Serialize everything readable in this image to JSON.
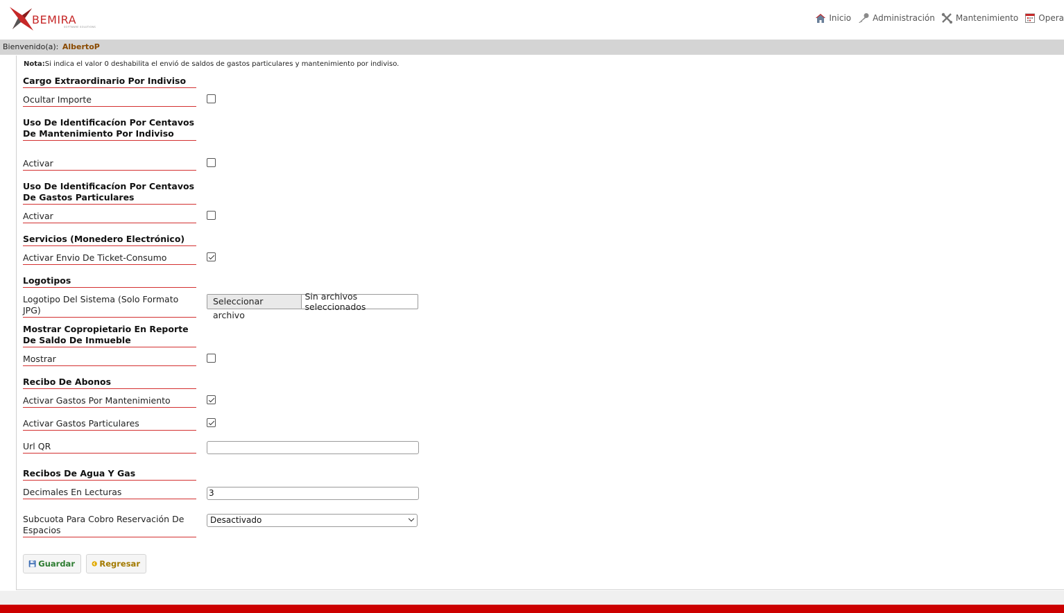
{
  "brand": {
    "logo_text": "BEMIRA",
    "logo_tagline": "SOFTWARE SOLUTIONS"
  },
  "topnav": [
    {
      "label": "Inicio",
      "icon": "home-icon"
    },
    {
      "label": "Administración",
      "icon": "key-icon"
    },
    {
      "label": "Mantenimiento",
      "icon": "tools-icon"
    },
    {
      "label": "Opera",
      "icon": "calendar-icon"
    }
  ],
  "welcome": {
    "prefix": "Bienvenido(a):",
    "user": "AlbertoP"
  },
  "note": {
    "label": "Nota:",
    "text": "Si indica el valor 0 deshabilita el envió de saldos de gastos particulares y mantenimiento por indiviso."
  },
  "form": {
    "cargo_heading": "Cargo Extraordinario Por Indiviso",
    "ocultar_importe": {
      "label": "Ocultar Importe",
      "checked": false
    },
    "uso_mant_heading": "Uso De Identificacíon Por Centavos De Mantenimiento Por Indiviso",
    "uso_mant_activar": {
      "label": "Activar",
      "checked": false
    },
    "uso_gastos_heading": "Uso De Identificacíon Por Centavos De Gastos Particulares",
    "uso_gastos_activar": {
      "label": "Activar",
      "checked": false
    },
    "servicios_heading": "Servicios (Monedero Electrónico)",
    "ticket_consumo": {
      "label": "Activar Envio De Ticket-Consumo",
      "checked": true
    },
    "logotipos_heading": "Logotipos",
    "logotipo_sistema": {
      "label": "Logotipo Del Sistema (Solo Formato JPG)",
      "button": "Seleccionar archivo",
      "status": "Sin archivos seleccionados"
    },
    "copropietario_heading": "Mostrar Copropietario En Reporte De Saldo De Inmueble",
    "mostrar": {
      "label": "Mostrar",
      "checked": false
    },
    "recibo_heading": "Recibo De Abonos",
    "gastos_mant": {
      "label": "Activar Gastos Por Mantenimiento",
      "checked": true
    },
    "gastos_part": {
      "label": "Activar Gastos Particulares",
      "checked": true
    },
    "url_qr": {
      "label": "Url QR",
      "value": ""
    },
    "agua_gas_heading": "Recibos De Agua Y Gas",
    "decimales": {
      "label": "Decimales En Lecturas",
      "value": "3"
    },
    "subcuota": {
      "label": "Subcuota Para Cobro Reservación De Espacios",
      "selected": "Desactivado"
    }
  },
  "buttons": {
    "save": "Guardar",
    "back": "Regresar"
  },
  "colors": {
    "accent_red": "#d32f2f",
    "footer_red": "#cc0000",
    "save_green": "#2e7d32",
    "back_gold": "#a37a00"
  }
}
